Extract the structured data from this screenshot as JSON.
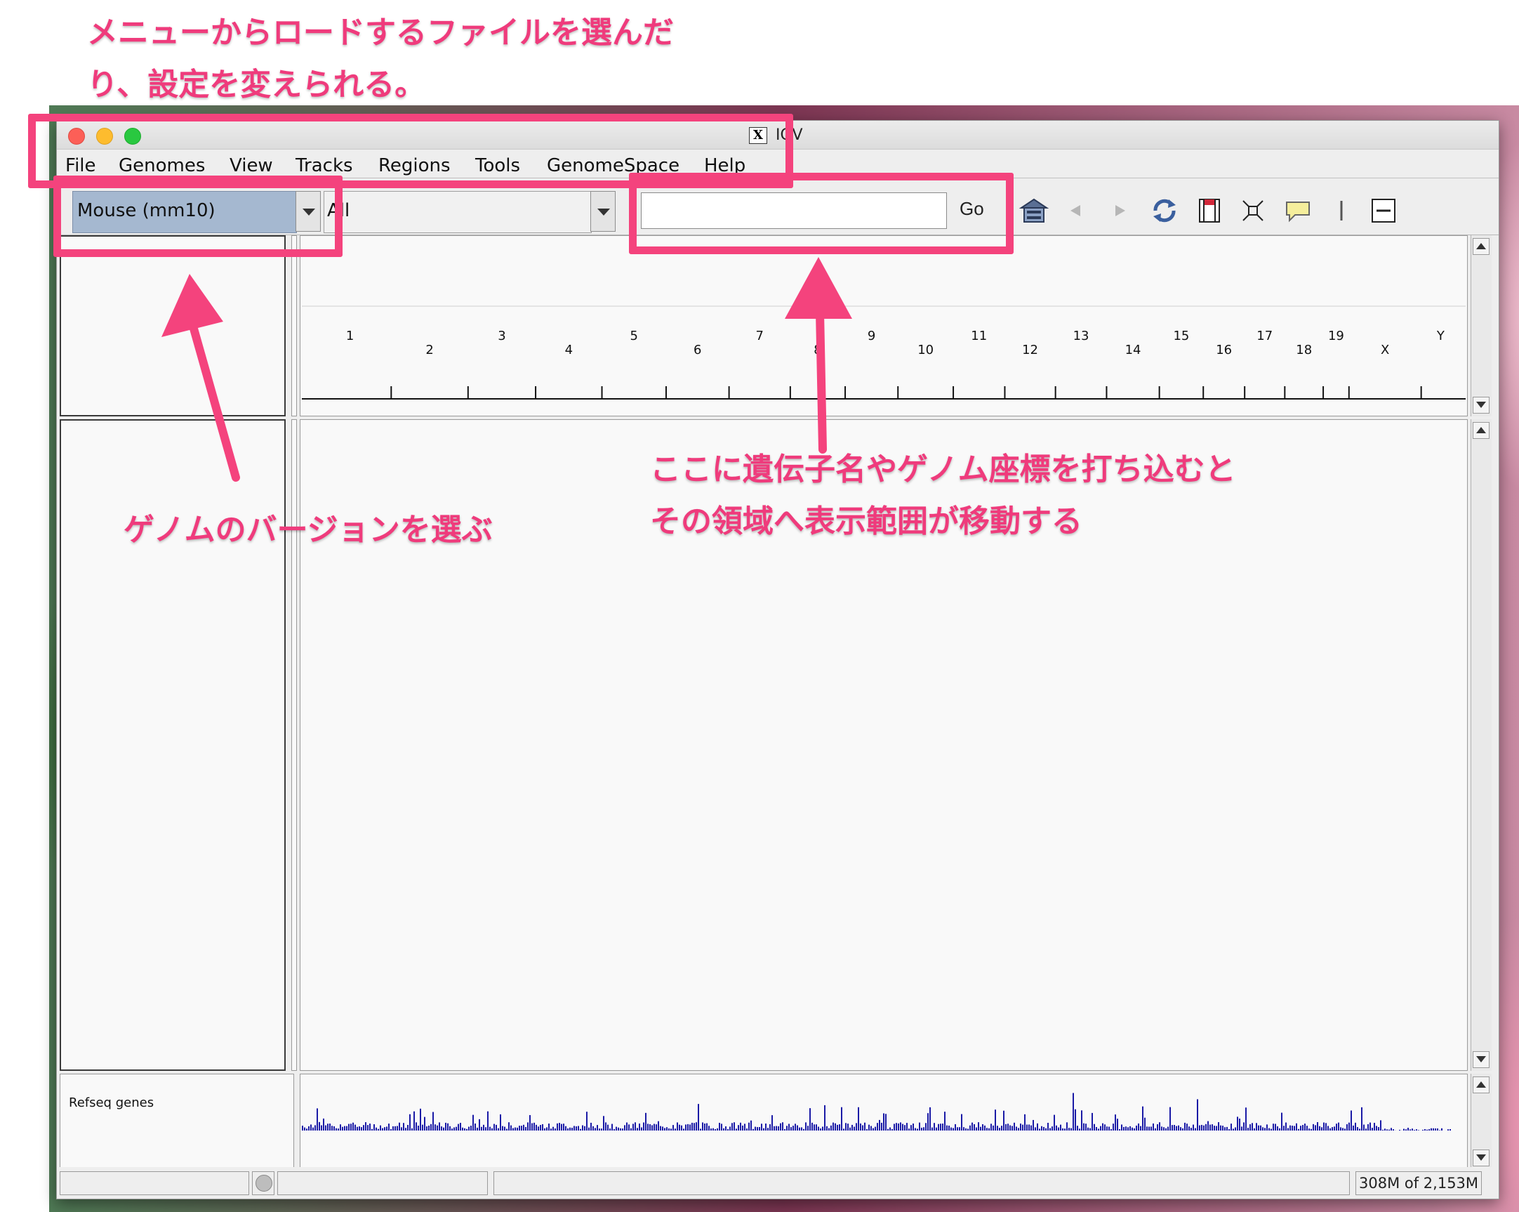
{
  "annotations": {
    "menu_note_line1": "メニューからロードするファイルを選んだ",
    "menu_note_line2": "り、設定を変えられる。",
    "genome_note": "ゲノムのバージョンを選ぶ",
    "locus_note_line1": "ここに遺伝子名やゲノム座標を打ち込むと",
    "locus_note_line2": "その領域へ表示範囲が移動する",
    "accent_color": "#f4437d"
  },
  "window": {
    "title": "IGV",
    "title_icon": "x11-icon"
  },
  "menubar": {
    "items": [
      "File",
      "Genomes",
      "View",
      "Tracks",
      "Regions",
      "Tools",
      "GenomeSpace",
      "Help"
    ]
  },
  "toolbar": {
    "genome": "Mouse (mm10)",
    "chromosome": "All",
    "locus_value": "",
    "go_label": "Go",
    "icons": [
      "home-icon",
      "back-arrow-icon",
      "forward-arrow-icon",
      "refresh-icon",
      "region-of-interest-icon",
      "fit-to-window-icon",
      "popup-text-icon",
      "ruler-divider-icon",
      "zoom-out-icon"
    ]
  },
  "ruler": {
    "chromosomes_top": [
      "1",
      "3",
      "5",
      "7",
      "9",
      "11",
      "13",
      "15",
      "17",
      "19",
      "Y"
    ],
    "chromosomes_bottom": [
      "2",
      "4",
      "6",
      "8",
      "10",
      "12",
      "14",
      "16",
      "18",
      "X"
    ]
  },
  "tracks": {
    "refseq_label": "Refseq genes",
    "track_color": "#1a1aa6"
  },
  "statusbar": {
    "memory": "308M of 2,153M"
  }
}
